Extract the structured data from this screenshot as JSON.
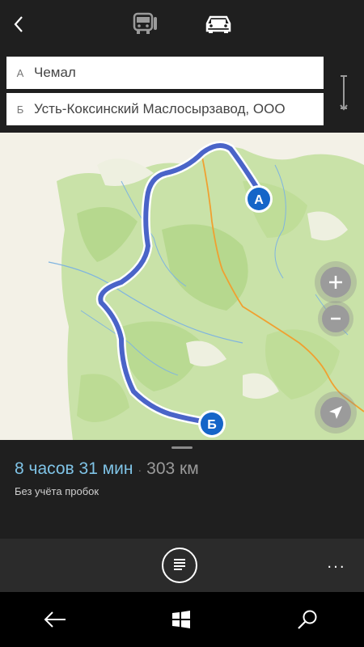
{
  "header": {
    "back_icon": "chevron-left-icon",
    "modes": [
      {
        "name": "transit",
        "icon": "bus-icon",
        "active": false
      },
      {
        "name": "car",
        "icon": "car-icon",
        "active": true
      }
    ]
  },
  "route": {
    "from": {
      "letter": "А",
      "value": "Чемал"
    },
    "to": {
      "letter": "Б",
      "value": "Усть-Коксинский Маслосырзавод, ООО"
    },
    "swap_icon": "swap-vertical-icon"
  },
  "map": {
    "marker_a": "A",
    "marker_b": "Б",
    "route_color": "#4a64c8",
    "marker_color": "#1565c8",
    "road_color": "#f0a030",
    "controls": [
      "zoom-in-icon",
      "zoom-out-icon",
      "locate-icon"
    ]
  },
  "summary": {
    "duration": "8 часов 31 мин",
    "separator": "·",
    "distance": "303 км",
    "traffic_note": "Без учёта пробок"
  },
  "appbar": {
    "list_icon": "list-icon",
    "more": "..."
  },
  "system_nav": [
    "back-arrow-icon",
    "windows-icon",
    "search-icon"
  ],
  "colors": {
    "accent": "#7fc3e6",
    "panel": "#1f1f1f"
  }
}
